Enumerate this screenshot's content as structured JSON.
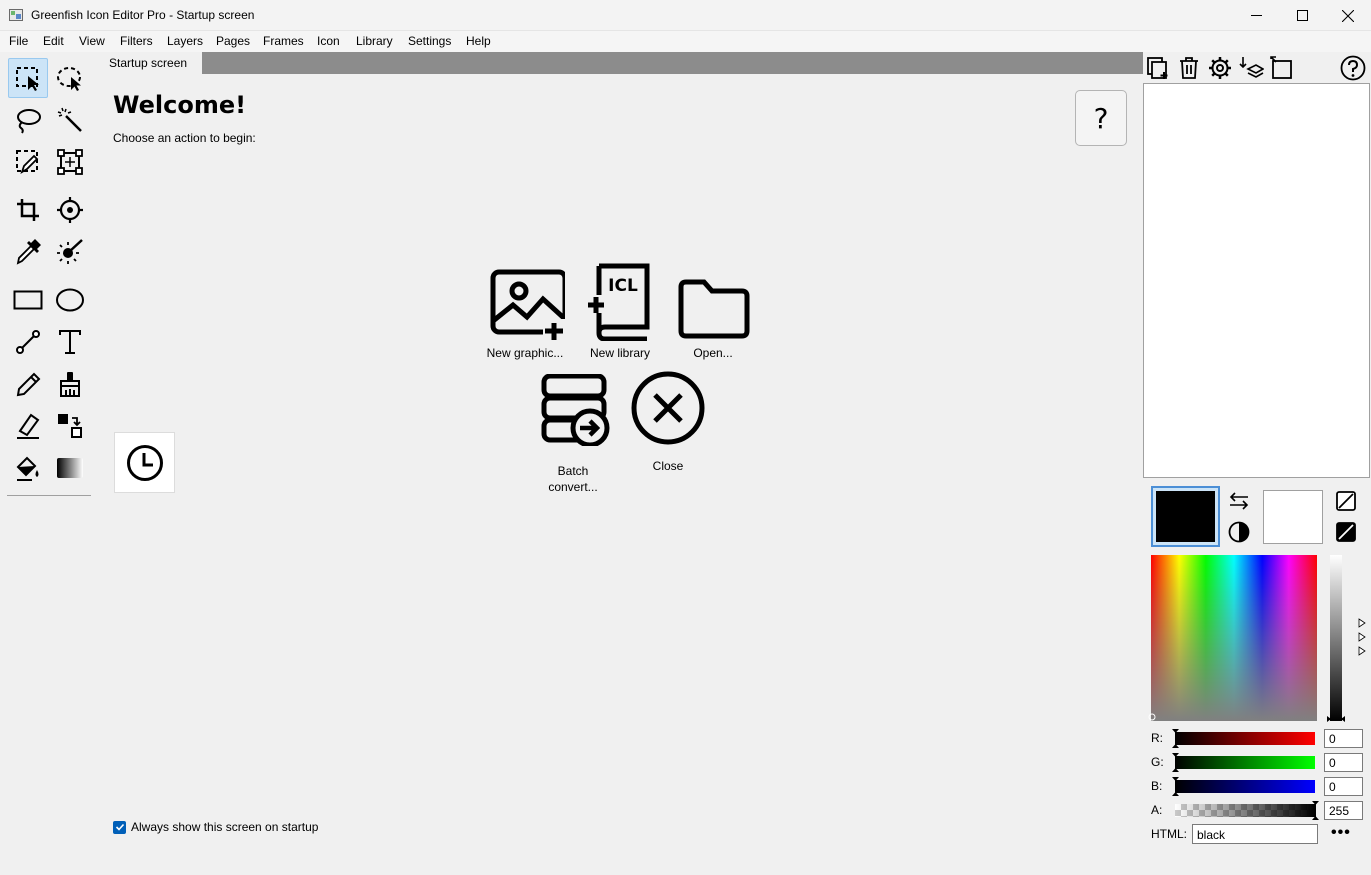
{
  "window": {
    "title": "Greenfish Icon Editor Pro - Startup screen"
  },
  "menu": [
    "File",
    "Edit",
    "View",
    "Filters",
    "Layers",
    "Pages",
    "Frames",
    "Icon",
    "Library",
    "Settings",
    "Help"
  ],
  "tools": [
    "select-rect-icon",
    "select-ellipse-icon",
    "lasso-icon",
    "magic-wand-icon",
    "select-pen-icon",
    "transform-icon",
    "crop-icon",
    "hotspot-icon",
    "color-picker-icon",
    "dodge-burn-icon",
    "rectangle-icon",
    "ellipse-icon",
    "line-icon",
    "text-icon",
    "pencil-icon",
    "brush-icon",
    "eraser-icon",
    "color-replace-icon",
    "fill-icon",
    "gradient-icon"
  ],
  "tab": {
    "label": "Startup screen"
  },
  "welcome": {
    "title": "Welcome!",
    "subtitle": "Choose an action to begin:",
    "help": "?"
  },
  "actions": {
    "new_graphic": "New graphic...",
    "new_library": "New library",
    "open": "Open...",
    "batch_line1": "Batch",
    "batch_line2": "convert...",
    "close": "Close",
    "icl_text": "ICL"
  },
  "startup": {
    "label": "Always show this screen on startup",
    "checked": true
  },
  "color": {
    "primary": "#000000",
    "secondary": "#ffffff",
    "r_label": "R:",
    "r": "0",
    "g_label": "G:",
    "g": "0",
    "b_label": "B:",
    "b": "0",
    "a_label": "A:",
    "a": "255",
    "html_label": "HTML:",
    "html": "black",
    "more": "•••"
  }
}
